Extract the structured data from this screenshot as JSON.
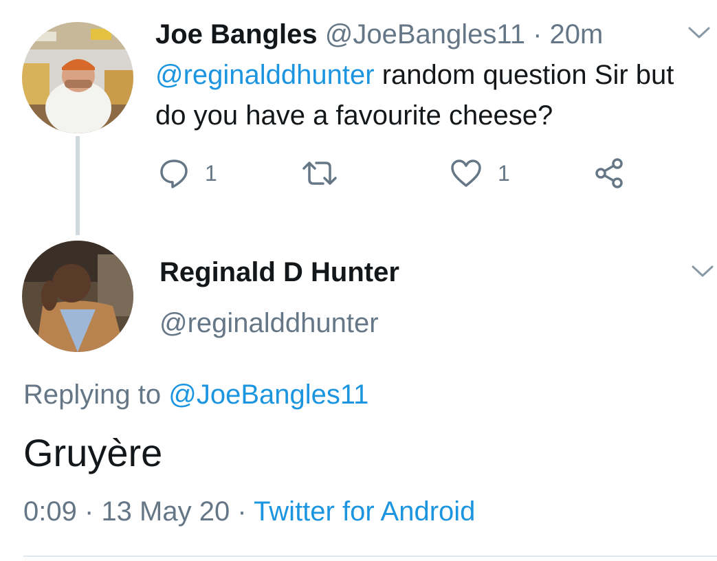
{
  "tweet": {
    "author_name": "Joe Bangles",
    "author_handle": "@JoeBangles11",
    "separator": "·",
    "time_ago": "20m",
    "mention": "@reginalddhunter",
    "text": " random question Sir but do you have a favourite cheese?",
    "reply_count": "1",
    "like_count": "1"
  },
  "reply": {
    "author_name": "Reginald D Hunter",
    "author_handle": "@reginalddhunter",
    "replying_label": "Replying to ",
    "replying_to": "@JoeBangles11",
    "text": "Gruyère",
    "time": "0:09",
    "date": "13 May 20",
    "separator": "·",
    "source": "Twitter for Android"
  },
  "icons": {
    "reply": "reply-icon",
    "retweet": "retweet-icon",
    "like": "heart-icon",
    "share": "share-icon",
    "menu": "chevron-down-icon"
  },
  "colors": {
    "link": "#1b95e0",
    "muted": "#657786",
    "text": "#14171a",
    "thread_line": "#cfd9de"
  }
}
